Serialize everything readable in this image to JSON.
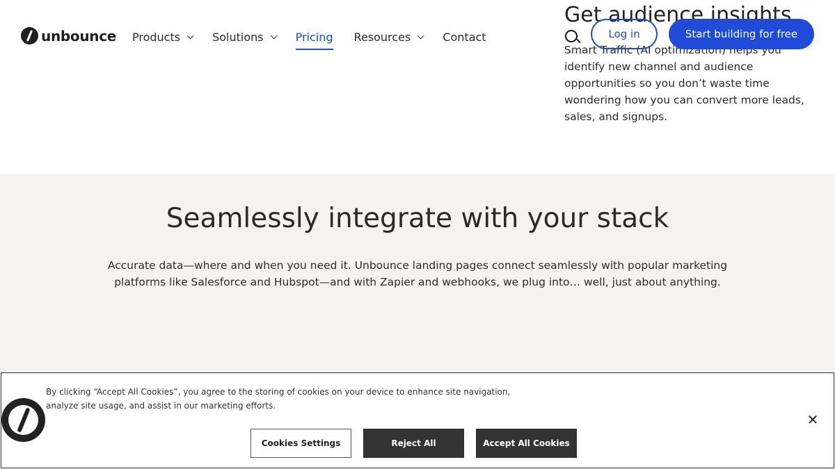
{
  "brand": {
    "name": "unbounce"
  },
  "nav": {
    "items": [
      {
        "label": "Products",
        "has_dropdown": true,
        "active": false
      },
      {
        "label": "Solutions",
        "has_dropdown": true,
        "active": false
      },
      {
        "label": "Pricing",
        "has_dropdown": false,
        "active": true
      },
      {
        "label": "Resources",
        "has_dropdown": true,
        "active": false
      },
      {
        "label": "Contact",
        "has_dropdown": false,
        "active": false
      }
    ],
    "login_label": "Log in",
    "cta_label": "Start building for free"
  },
  "feature": {
    "title": "Get audience insights",
    "body": "Smart Traffic (AI optimization) helps you identify new channel and audience opportunities so you don’t waste time wondering how you can convert more leads, sales, and signups."
  },
  "integrate": {
    "title": "Seamlessly integrate with your stack",
    "description": "Accurate data—where and when you need it. Unbounce landing pages connect seamlessly with popular marketing platforms like Salesforce and Hubspot—and with Zapier and webhooks, we plug into… well, just about anything."
  },
  "cookie": {
    "text": "By clicking “Accept All Cookies”, you agree to the storing of cookies on your device to enhance site navigation, analyze site usage, and assist in our marketing efforts.",
    "settings_label": "Cookies Settings",
    "reject_label": "Reject All",
    "accept_label": "Accept All Cookies",
    "close_glyph": "✕"
  },
  "colors": {
    "accent": "#1f4bd8",
    "section_bg": "#f4f3f1",
    "cookie_button_dark": "#333333"
  }
}
